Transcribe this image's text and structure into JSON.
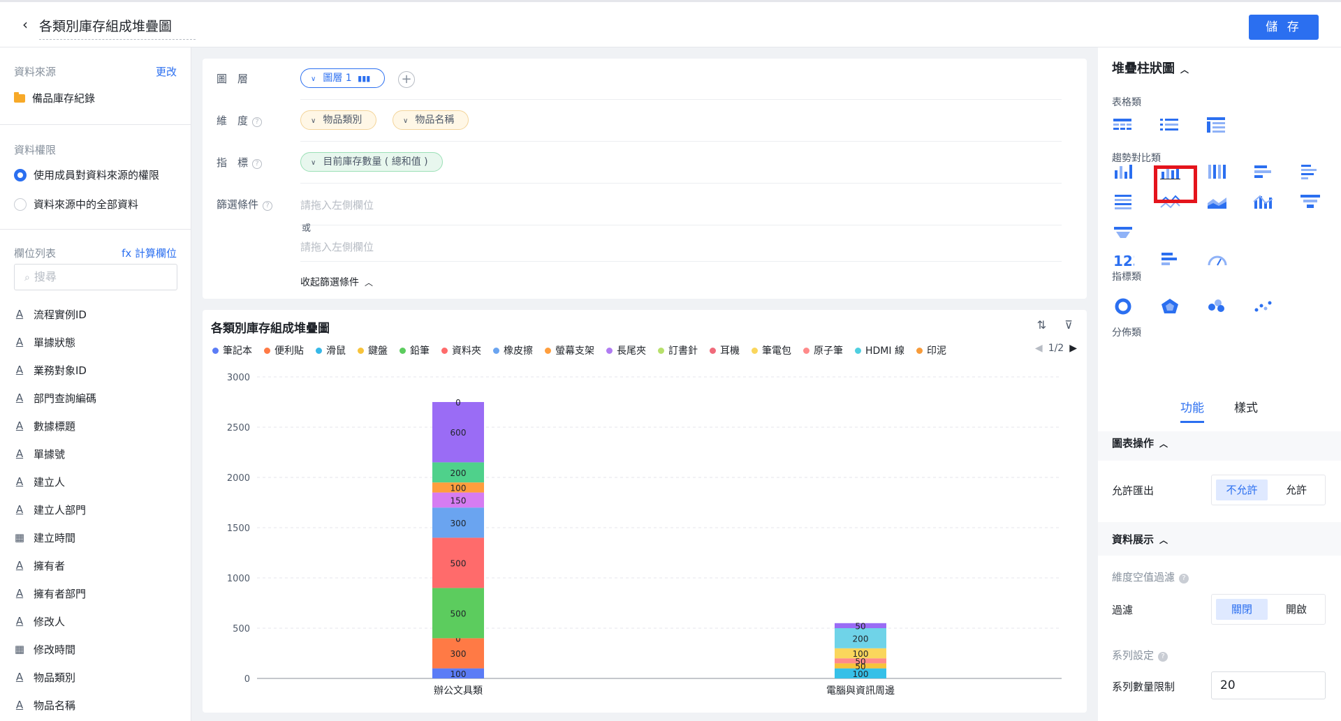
{
  "header": {
    "title": "各類別庫存組成堆疊圖",
    "save_label": "儲 存"
  },
  "left": {
    "source_label": "資料來源",
    "source_change": "更改",
    "source_name": "備品庫存紀錄",
    "permission_label": "資料權限",
    "permission_options": [
      "使用成員對資料來源的權限",
      "資料來源中的全部資料"
    ],
    "fields_label": "欄位列表",
    "calc_field": "fx 計算欄位",
    "search_placeholder": "搜尋",
    "fields": [
      {
        "icon": "A",
        "name": "流程實例ID"
      },
      {
        "icon": "A",
        "name": "單據狀態"
      },
      {
        "icon": "A",
        "name": "業務對象ID"
      },
      {
        "icon": "A",
        "name": "部門查詢編碼"
      },
      {
        "icon": "A",
        "name": "數據標題"
      },
      {
        "icon": "A",
        "name": "單據號"
      },
      {
        "icon": "A",
        "name": "建立人"
      },
      {
        "icon": "A",
        "name": "建立人部門"
      },
      {
        "icon": "cal",
        "name": "建立時間"
      },
      {
        "icon": "A",
        "name": "擁有者"
      },
      {
        "icon": "A",
        "name": "擁有者部門"
      },
      {
        "icon": "A",
        "name": "修改人"
      },
      {
        "icon": "cal",
        "name": "修改時間"
      },
      {
        "icon": "A",
        "name": "物品類別"
      },
      {
        "icon": "A",
        "name": "物品名稱"
      }
    ]
  },
  "config": {
    "layer_label": "圖　層",
    "layer_pill": "圖層 1",
    "dimension_label": "維　度",
    "dimensions": [
      "物品類別",
      "物品名稱"
    ],
    "metric_label": "指　標",
    "metric": "目前庫存數量 ( 總和值 )",
    "filter_label": "篩選條件",
    "filter_hint": "請拖入左側欄位",
    "or_label": "或",
    "collapse_label": "收起篩選條件"
  },
  "chart": {
    "title": "各類別庫存組成堆疊圖",
    "pager": "1/2",
    "legend": [
      {
        "name": "筆記本",
        "color": "#5b7cf6"
      },
      {
        "name": "便利貼",
        "color": "#ff7a45"
      },
      {
        "name": "滑鼠",
        "color": "#36b8e8"
      },
      {
        "name": "鍵盤",
        "color": "#f7c33b"
      },
      {
        "name": "鉛筆",
        "color": "#5ccc5e"
      },
      {
        "name": "資料夾",
        "color": "#ff6b6b"
      },
      {
        "name": "橡皮擦",
        "color": "#6aa4f0"
      },
      {
        "name": "螢幕支架",
        "color": "#ff9e3d"
      },
      {
        "name": "長尾夾",
        "color": "#b07cf2"
      },
      {
        "name": "訂書針",
        "color": "#b7e06b"
      },
      {
        "name": "耳機",
        "color": "#f06a7a"
      },
      {
        "name": "筆電包",
        "color": "#fad65c"
      },
      {
        "name": "原子筆",
        "color": "#ff8a8a"
      },
      {
        "name": "HDMI 線",
        "color": "#4fcfe0"
      },
      {
        "name": "印泥",
        "color": "#f79b3a"
      }
    ]
  },
  "chart_data": {
    "type": "bar",
    "stacked": true,
    "categories": [
      "辦公文具類",
      "電腦與資訊周邊"
    ],
    "ylim": [
      0,
      3000
    ],
    "yticks": [
      0,
      500,
      1000,
      1500,
      2000,
      2500,
      3000
    ],
    "grid": true,
    "legend_position": "top-left",
    "stacks": [
      [
        {
          "series": "筆記本",
          "value": 100,
          "color": "#5b7cf6"
        },
        {
          "series": "便利貼",
          "value": 300,
          "color": "#ff7a45"
        },
        {
          "series": "",
          "value": 0,
          "color": "#ff7a45"
        },
        {
          "series": "鉛筆",
          "value": 500,
          "color": "#5ccc5e"
        },
        {
          "series": "資料夾",
          "value": 500,
          "color": "#ff6b6b"
        },
        {
          "series": "橡皮擦",
          "value": 300,
          "color": "#6aa4f0"
        },
        {
          "series": "長尾夾",
          "value": 150,
          "color": "#d67cf2"
        },
        {
          "series": "螢幕支架",
          "value": 100,
          "color": "#ff9e3d"
        },
        {
          "series": "",
          "value": 200,
          "color": "#4fd18b"
        },
        {
          "series": "",
          "value": 600,
          "color": "#9a6cf5"
        },
        {
          "series": "",
          "value": 0,
          "color": "#9a6cf5"
        }
      ],
      [
        {
          "series": "滑鼠",
          "value": 100,
          "color": "#36c0e8"
        },
        {
          "series": "鍵盤",
          "value": 50,
          "color": "#f7c33b"
        },
        {
          "series": "耳機",
          "value": 50,
          "color": "#ff8a8a"
        },
        {
          "series": "筆電包",
          "value": 100,
          "color": "#fad65c"
        },
        {
          "series": "HDMI 線",
          "value": 200,
          "color": "#6fd3e8"
        },
        {
          "series": "",
          "value": 50,
          "color": "#9a6cf5"
        }
      ]
    ]
  },
  "right": {
    "chart_type": "堆疊柱狀圖",
    "groups": [
      "表格類",
      "趨勢對比類",
      "指標類",
      "分佈類"
    ],
    "tabs": [
      "功能",
      "樣式"
    ],
    "chart_ops": "圖表操作",
    "allow_export": "允許匯出",
    "export_opts": [
      "不允許",
      "允許"
    ],
    "data_display": "資料展示",
    "dim_null_filter": "維度空值過濾",
    "filter_label": "過濾",
    "filter_opts": [
      "關閉",
      "開啟"
    ],
    "series_settings": "系列設定",
    "series_limit_label": "系列數量限制",
    "series_limit_value": "20"
  }
}
